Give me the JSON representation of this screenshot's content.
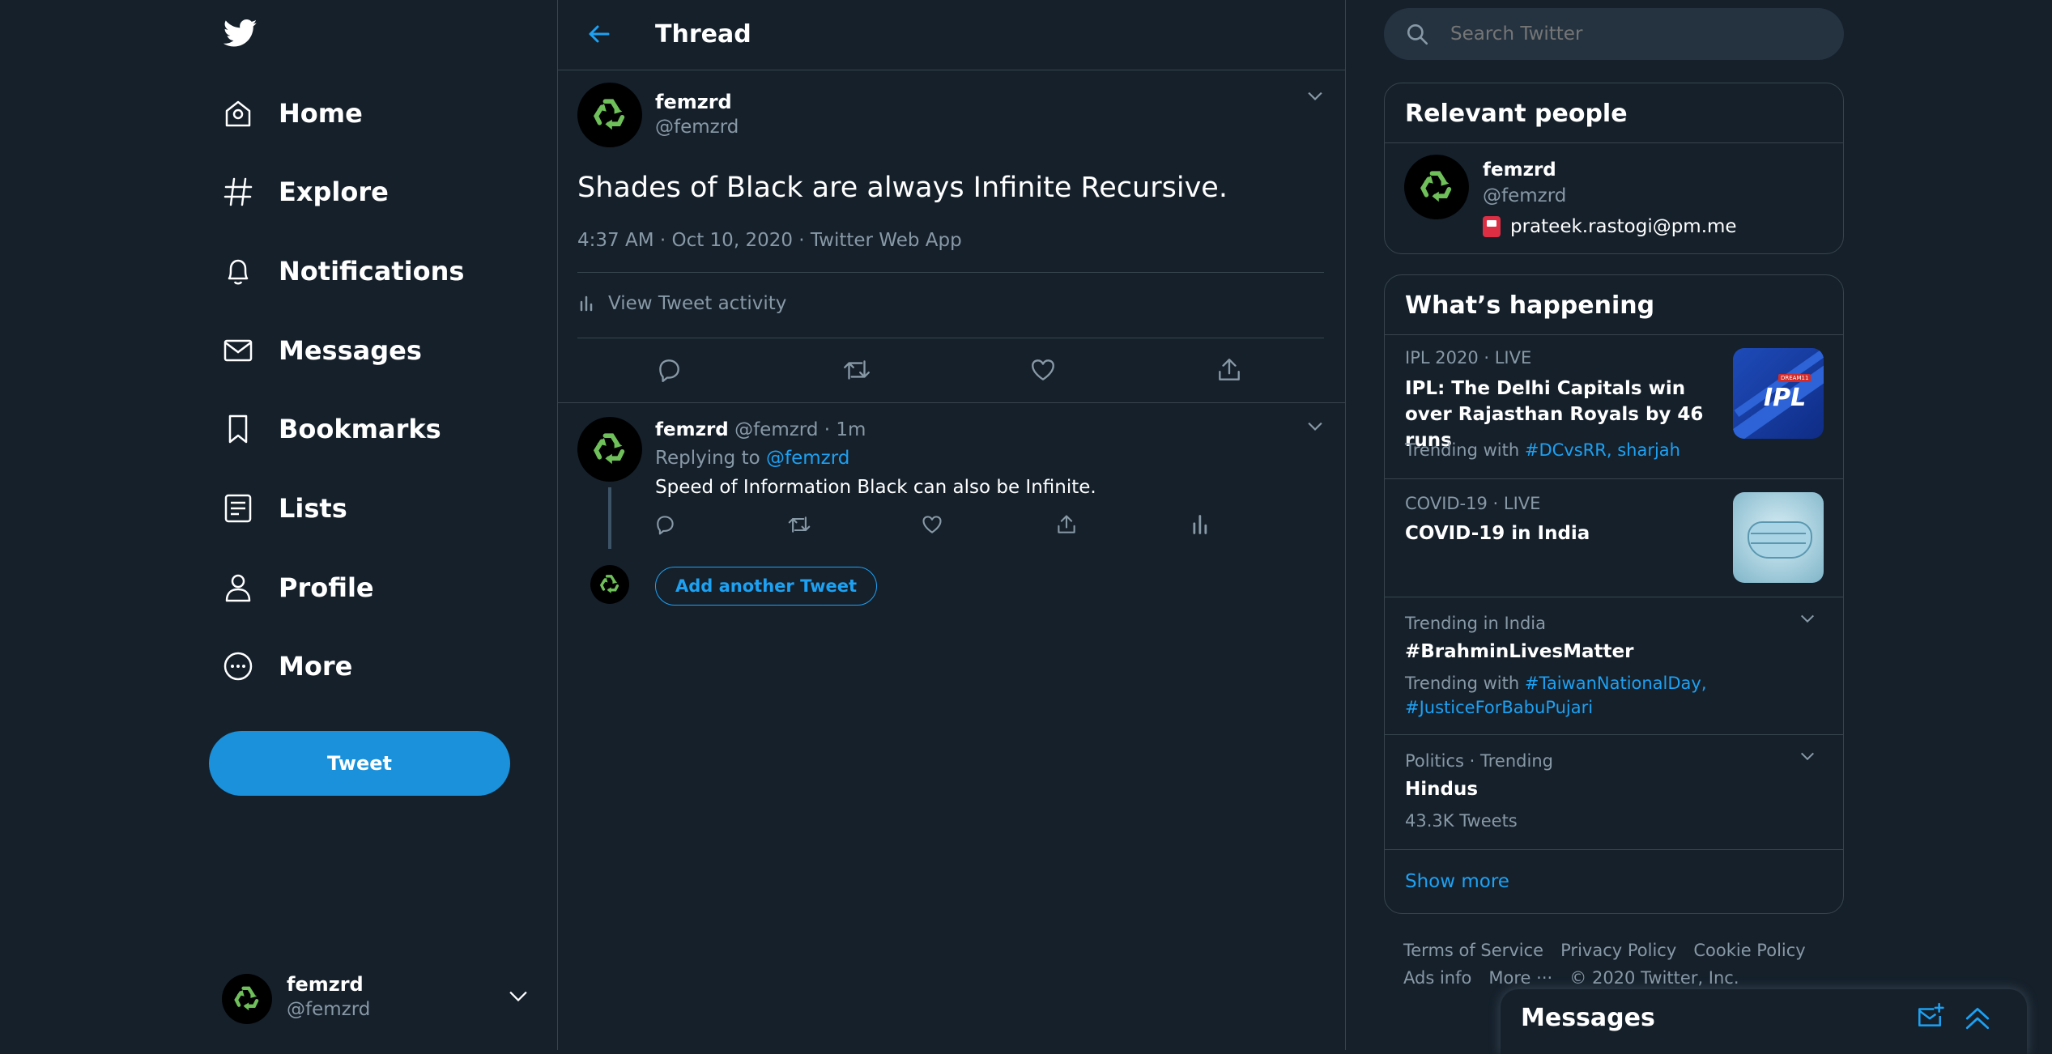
{
  "nav": {
    "items": [
      {
        "label": "Home",
        "icon": "home-icon"
      },
      {
        "label": "Explore",
        "icon": "hashtag-icon"
      },
      {
        "label": "Notifications",
        "icon": "bell-icon"
      },
      {
        "label": "Messages",
        "icon": "envelope-icon"
      },
      {
        "label": "Bookmarks",
        "icon": "bookmark-icon"
      },
      {
        "label": "Lists",
        "icon": "list-icon"
      },
      {
        "label": "Profile",
        "icon": "person-icon"
      },
      {
        "label": "More",
        "icon": "more-circle-icon"
      }
    ],
    "tweet_label": "Tweet",
    "account": {
      "name": "femzrd",
      "handle": "@femzrd"
    }
  },
  "thread": {
    "title": "Thread",
    "tweet": {
      "name": "femzrd",
      "handle": "@femzrd",
      "text": "Shades of Black are always Infinite Recursive.",
      "meta": "4:37 AM · Oct 10, 2020 · Twitter Web App",
      "activity_label": "View Tweet activity"
    },
    "reply": {
      "name": "femzrd",
      "handle": "@femzrd",
      "sep": "·",
      "time": "1m",
      "replying_prefix": "Replying to",
      "replying_to": "@femzrd",
      "text": "Speed of Information Black can also be Infinite."
    },
    "add_tweet_label": "Add another Tweet"
  },
  "search": {
    "placeholder": "Search Twitter"
  },
  "relevant": {
    "title": "Relevant people",
    "name": "femzrd",
    "handle": "@femzrd",
    "email": "prateek.rastogi@pm.me"
  },
  "happening": {
    "title": "What’s happening",
    "trends": [
      {
        "context": "IPL 2020 · LIVE",
        "title": "IPL: The Delhi Capitals win over Rajasthan Royals by 46 runs",
        "trending_prefix": "Trending with",
        "tags": "#DCvsRR, sharjah",
        "image_text": "IPL",
        "image_badge": "DREAM11"
      },
      {
        "context": "COVID-19 · LIVE",
        "title": "COVID-19 in India"
      },
      {
        "context": "Trending in India",
        "title": "#BrahminLivesMatter",
        "trending_prefix": "Trending with",
        "tags": "#TaiwanNationalDay,",
        "tags2": "#JusticeForBabuPujari"
      },
      {
        "context": "Politics · Trending",
        "title": "Hindus",
        "count": "43.3K Tweets"
      }
    ],
    "show_more": "Show more"
  },
  "footer": {
    "links": [
      "Terms of Service",
      "Privacy Policy",
      "Cookie Policy"
    ],
    "links2": [
      "Ads info",
      "More ···",
      "© 2020 Twitter, Inc."
    ]
  },
  "messages_drawer": {
    "title": "Messages"
  },
  "colors": {
    "background": "#15202b",
    "accent": "#1da1f2",
    "border": "#38444d",
    "muted": "#8899a6",
    "tweet_button": "#1a91da"
  }
}
